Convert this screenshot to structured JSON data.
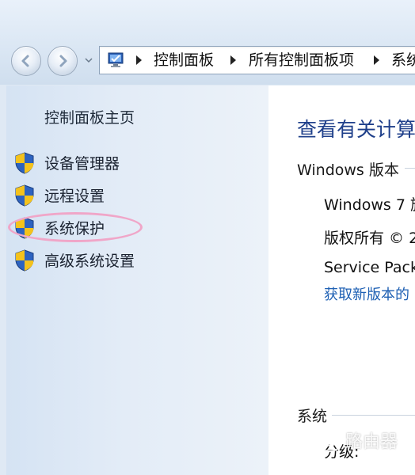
{
  "address_bar": {
    "breadcrumbs": [
      "控制面板",
      "所有控制面板项",
      "系统"
    ]
  },
  "sidebar": {
    "home_link": "控制面板主页",
    "tasks": [
      {
        "label": "设备管理器",
        "icon": "uac-shield-icon"
      },
      {
        "label": "远程设置",
        "icon": "uac-shield-icon"
      },
      {
        "label": "系统保护",
        "icon": "uac-shield-icon",
        "highlighted": true
      },
      {
        "label": "高级系统设置",
        "icon": "uac-shield-icon"
      }
    ]
  },
  "main": {
    "heading": "查看有关计算",
    "edition_title": "Windows 版本",
    "edition": {
      "name": "Windows 7 旗",
      "copyright": "版权所有 © 2",
      "service_pack": "Service Pack",
      "more_link": "获取新版本的"
    },
    "system_title": "系统",
    "rating_label": "分级:"
  },
  "watermark": {
    "text": "路由器"
  },
  "colors": {
    "heading": "#1e3f8a",
    "link": "#1d5fb3",
    "highlight": "#f0a6c8"
  }
}
